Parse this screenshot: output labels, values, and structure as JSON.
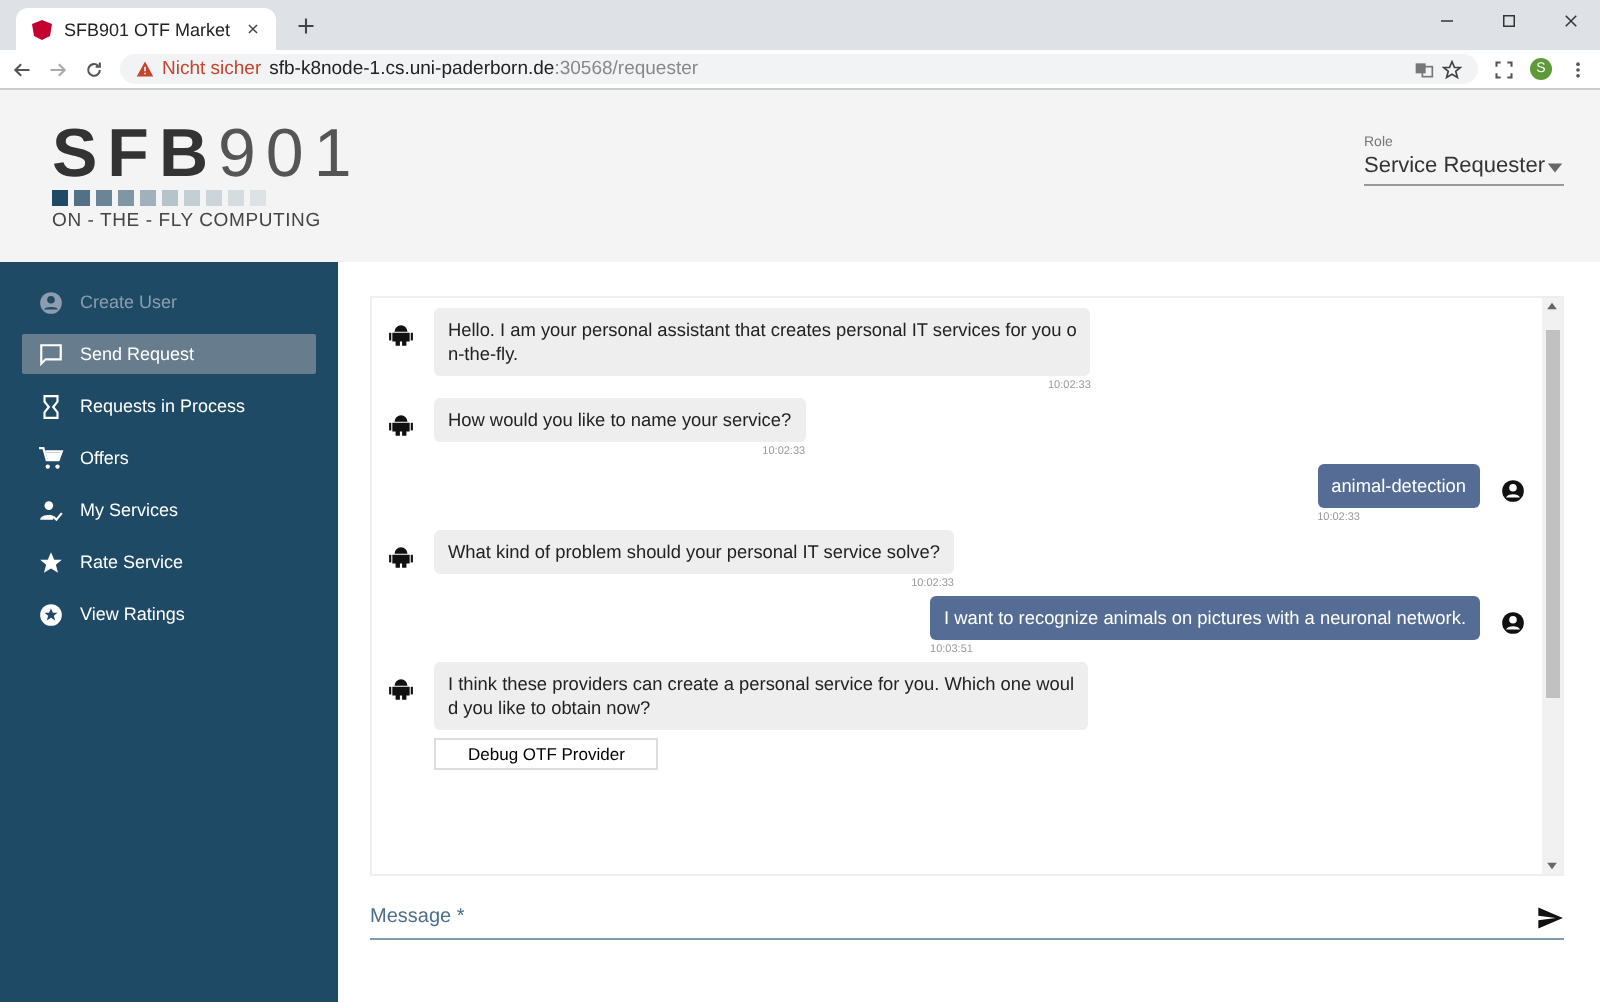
{
  "browser": {
    "tab_title": "SFB901 OTF Market",
    "security": "Nicht sicher",
    "url_host": "sfb-k8node-1.cs.uni-paderborn.de",
    "url_path": ":30568/requester",
    "profile": "S"
  },
  "logo": {
    "title_bold": "SFB",
    "title_light": "901",
    "tagline": "ON - THE - FLY COMPUTING"
  },
  "role": {
    "label": "Role",
    "value": "Service Requester"
  },
  "sidebar": {
    "items": [
      {
        "label": "Create User",
        "selected": false,
        "disabled": true
      },
      {
        "label": "Send Request",
        "selected": true,
        "disabled": false
      },
      {
        "label": "Requests in Process",
        "selected": false,
        "disabled": false
      },
      {
        "label": "Offers",
        "selected": false,
        "disabled": false
      },
      {
        "label": "My Services",
        "selected": false,
        "disabled": false
      },
      {
        "label": "Rate Service",
        "selected": false,
        "disabled": false
      },
      {
        "label": "View Ratings",
        "selected": false,
        "disabled": false
      }
    ]
  },
  "messages": [
    {
      "kind": "bot",
      "text": "Hello. I am your personal assistant that creates personal IT services for you o\nn-the-fly.",
      "time": "10:02:33"
    },
    {
      "kind": "bot",
      "text": "How would you like to name your service?",
      "time": "10:02:33"
    },
    {
      "kind": "user",
      "text": "animal-detection",
      "time": "10:02:33"
    },
    {
      "kind": "bot",
      "text": "What kind of problem should your personal IT service solve?",
      "time": "10:02:33"
    },
    {
      "kind": "user",
      "text": "I want to recognize animals on pictures with a neuronal network.",
      "time": "10:03:51"
    },
    {
      "kind": "bot",
      "text": "I think these providers can create a personal service for you. Which one woul\nd you like to obtain now?",
      "options": [
        "Debug OTF Provider"
      ]
    }
  ],
  "input": {
    "placeholder": "Message *"
  }
}
